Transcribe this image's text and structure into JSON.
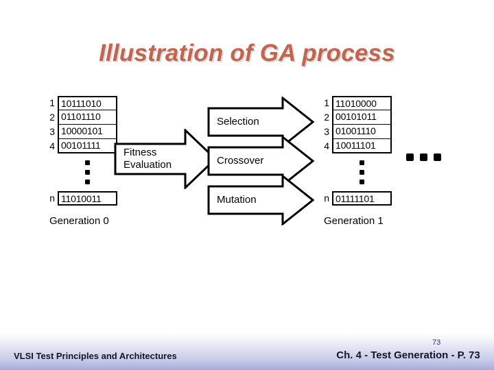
{
  "slide": {
    "title": "Illustration of GA process",
    "title_color": "#c4634e"
  },
  "diagram": {
    "generation_0": {
      "label": "Generation 0",
      "rows": [
        {
          "index": "1",
          "bits": "10111010"
        },
        {
          "index": "2",
          "bits": "01101110"
        },
        {
          "index": "3",
          "bits": "10000101"
        },
        {
          "index": "4",
          "bits": "00101111"
        }
      ],
      "ellipsis": "vertical-dots",
      "last_row": {
        "index": "n",
        "bits": "11010011"
      }
    },
    "generation_1": {
      "label": "Generation 1",
      "rows": [
        {
          "index": "1",
          "bits": "11010000"
        },
        {
          "index": "2",
          "bits": "00101011"
        },
        {
          "index": "3",
          "bits": "01001110"
        },
        {
          "index": "4",
          "bits": "10011101"
        }
      ],
      "ellipsis": "vertical-dots",
      "last_row": {
        "index": "n",
        "bits": "01111101"
      },
      "trailing_ellipsis": "horizontal-dots"
    },
    "stages": {
      "fitness_line1": "Fitness",
      "fitness_line2": "Evaluation",
      "selection": "Selection",
      "crossover": "Crossover",
      "mutation": "Mutation"
    }
  },
  "footer": {
    "left_text": "VLSI Test Principles and Architectures",
    "right_text": "Ch. 4 - Test Generation - P. 73",
    "page_number": "73"
  }
}
